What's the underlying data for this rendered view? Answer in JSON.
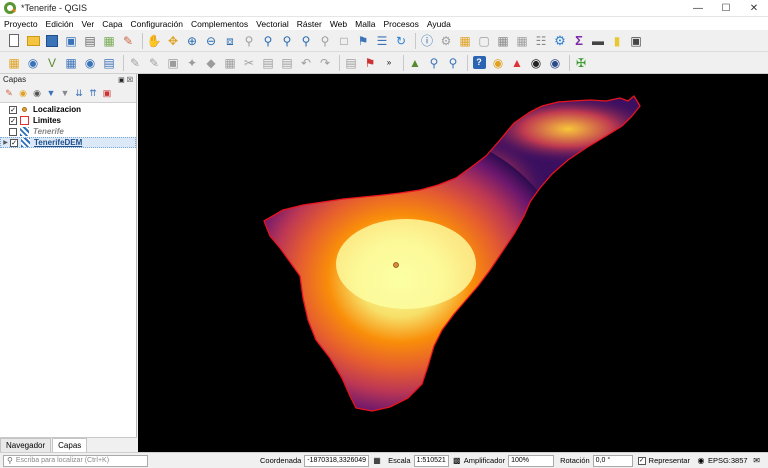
{
  "window": {
    "title": "*Tenerife - QGIS"
  },
  "menu": [
    "Proyecto",
    "Edición",
    "Ver",
    "Capa",
    "Configuración",
    "Complementos",
    "Vectorial",
    "Ráster",
    "Web",
    "Malla",
    "Procesos",
    "Ayuda"
  ],
  "layers_panel": {
    "title": "Capas",
    "layers": [
      {
        "name": "Localizacion",
        "checked": true,
        "style": "bold",
        "symbol": "point"
      },
      {
        "name": "Limites",
        "checked": true,
        "style": "bold",
        "symbol": "polygon"
      },
      {
        "name": "Tenerife",
        "checked": false,
        "style": "italic",
        "symbol": "raster"
      },
      {
        "name": "TenerifeDEM",
        "checked": true,
        "style": "selected",
        "symbol": "raster"
      }
    ]
  },
  "panel_tabs": [
    "Navegador",
    "Capas"
  ],
  "statusbar": {
    "locator_placeholder": "Escriba para localizar (Ctrl+K)",
    "coordinate_label": "Coordenada",
    "coordinate_value": "-1870318,3326049",
    "scale_label": "Escala",
    "scale_value": "1:510521",
    "magnifier_label": "Amplificador",
    "magnifier_value": "100%",
    "rotation_label": "Rotación",
    "rotation_value": "0,0 °",
    "render_label": "Representar",
    "crs": "EPSG:3857"
  },
  "colors": {
    "boundary": "#e8141e",
    "point": "#d88a3a",
    "canvas_bg": "#000000"
  }
}
